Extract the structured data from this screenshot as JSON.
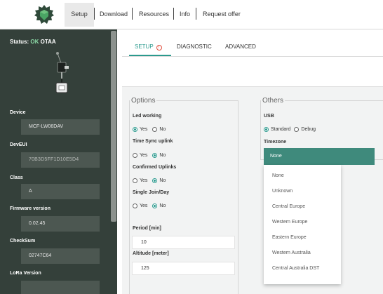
{
  "nav": {
    "logo_icon": "gear-shield-logo-icon",
    "items": [
      "Setup",
      "Download",
      "Resources",
      "Info",
      "Request offer"
    ]
  },
  "sidebar": {
    "status_prefix": "Status:",
    "status_ok": "OK",
    "status_mode": "OTAA",
    "fields": [
      {
        "label": "Device",
        "value": "MCF-LW06DAV"
      },
      {
        "label": "DevEUI",
        "value": "70B3D5FF1D10E5D4"
      },
      {
        "label": "Class",
        "value": "A"
      },
      {
        "label": "Firmware version",
        "value": "0.02.45"
      },
      {
        "label": "CheckSum",
        "value": "02747C64"
      },
      {
        "label": "LoRa Version",
        "value": ""
      }
    ]
  },
  "tabs": [
    "SETUP",
    "DIAGNOSTIC",
    "ADVANCED"
  ],
  "options": {
    "legend": "Options",
    "led_label": "Led working",
    "time_sync_label": "Time Sync uplink",
    "confirmed_label": "Confirmed Uplinks",
    "single_join_label": "Single Join/Day",
    "yes": "Yes",
    "no": "No",
    "period_label": "Period [min]",
    "period_value": "10",
    "altitude_label": "Altitude [meter]",
    "altitude_value": "125"
  },
  "others": {
    "legend": "Others",
    "usb_label": "USB",
    "usb_standard": "Standard",
    "usb_debug": "Debug",
    "timezone_label": "Timezone",
    "timezone_value": "None",
    "timezone_options": [
      "None",
      "Unknown",
      "Central Europe",
      "Western Europe",
      "Eastern Europe",
      "Western Australia",
      "Central Australia DST"
    ]
  },
  "colors": {
    "accent": "#2b9a8e",
    "sidebar": "#34403a",
    "select": "#3f8a7c",
    "error": "#e05040"
  }
}
